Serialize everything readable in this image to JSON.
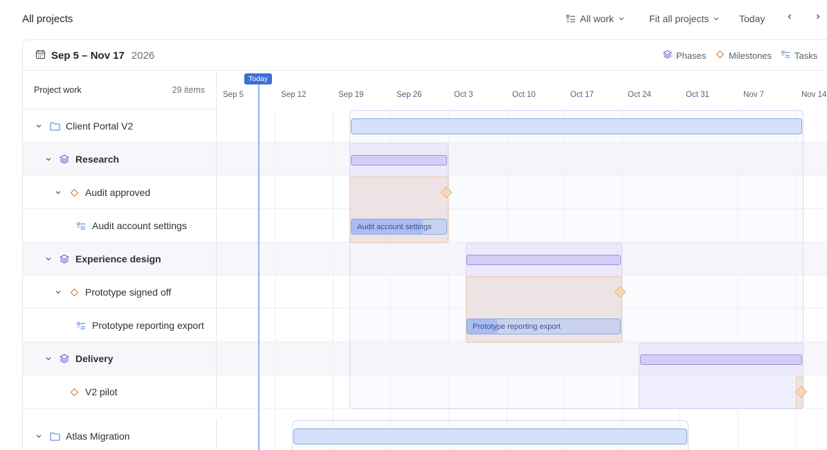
{
  "topbar": {
    "title": "All projects",
    "filter_label": "All work",
    "fit_label": "Fit all projects",
    "today_label": "Today"
  },
  "header": {
    "range": "Sep 5 – Nov 17",
    "year": "2026",
    "legend": {
      "phases": "Phases",
      "milestones": "Milestones",
      "tasks": "Tasks"
    }
  },
  "list_header": {
    "label": "Project work",
    "count": "29 items"
  },
  "timeline": {
    "today_label": "Today",
    "ticks": [
      "Sep 5",
      "Sep 12",
      "Sep 19",
      "Sep 26",
      "Oct 3",
      "Oct 10",
      "Oct 17",
      "Oct 24",
      "Oct 31",
      "Nov 7",
      "Nov 14"
    ]
  },
  "rows": [
    {
      "type": "project",
      "label": "Client Portal V2"
    },
    {
      "type": "phase",
      "label": "Research"
    },
    {
      "type": "milestone",
      "label": "Audit approved"
    },
    {
      "type": "task",
      "label": "Audit account settings",
      "bar_label": "Audit account settings",
      "progress": 0.75
    },
    {
      "type": "phase",
      "label": "Experience design"
    },
    {
      "type": "milestone",
      "label": "Prototype signed off"
    },
    {
      "type": "task",
      "label": "Prototype reporting export",
      "bar_label": "Prototype reporting export",
      "progress": 0.2
    },
    {
      "type": "phase",
      "label": "Delivery"
    },
    {
      "type": "milestone",
      "label": "V2 pilot"
    },
    {
      "type": "project",
      "label": "Atlas Migration"
    }
  ],
  "colors": {
    "accent": "#3b6fd8",
    "project": "#d4e1fa",
    "phase": "#d5cdf6",
    "milestone": "#f8d9b3",
    "task": "#a9bdf2"
  }
}
